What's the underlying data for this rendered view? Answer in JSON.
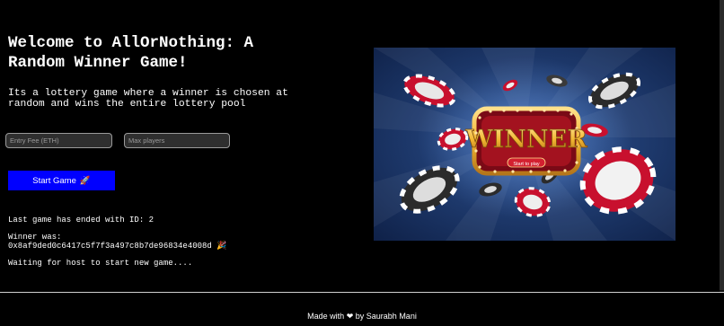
{
  "intro": {
    "title": "Welcome to AllOrNothing: A Random Winner Game!",
    "description": "Its a lottery game where a winner is chosen at random and wins the entire lottery pool"
  },
  "form": {
    "entry_fee_placeholder": "Entry Fee (ETH)",
    "max_players_placeholder": "Max players",
    "start_label": "Start Game",
    "start_emoji": "🚀"
  },
  "status": {
    "last_game": "Last game has ended with ID: 2",
    "winner_label": "Winner was:",
    "winner_address": "0x8af9ded0c6417c5f7f3a497c8b7de96834e4008d",
    "winner_emoji": "🎉",
    "waiting": "Waiting for host to start new game...."
  },
  "hero": {
    "sign_text": "WINNER",
    "sign_button": "Start to play",
    "colors": {
      "chip_red": "#c8102e",
      "chip_dark": "#2b2b2b",
      "gold": "#f2b632",
      "background": "#1f3a6e"
    }
  },
  "footer": {
    "prefix": "Made with",
    "heart": "❤",
    "suffix": "by Saurabh Mani"
  }
}
